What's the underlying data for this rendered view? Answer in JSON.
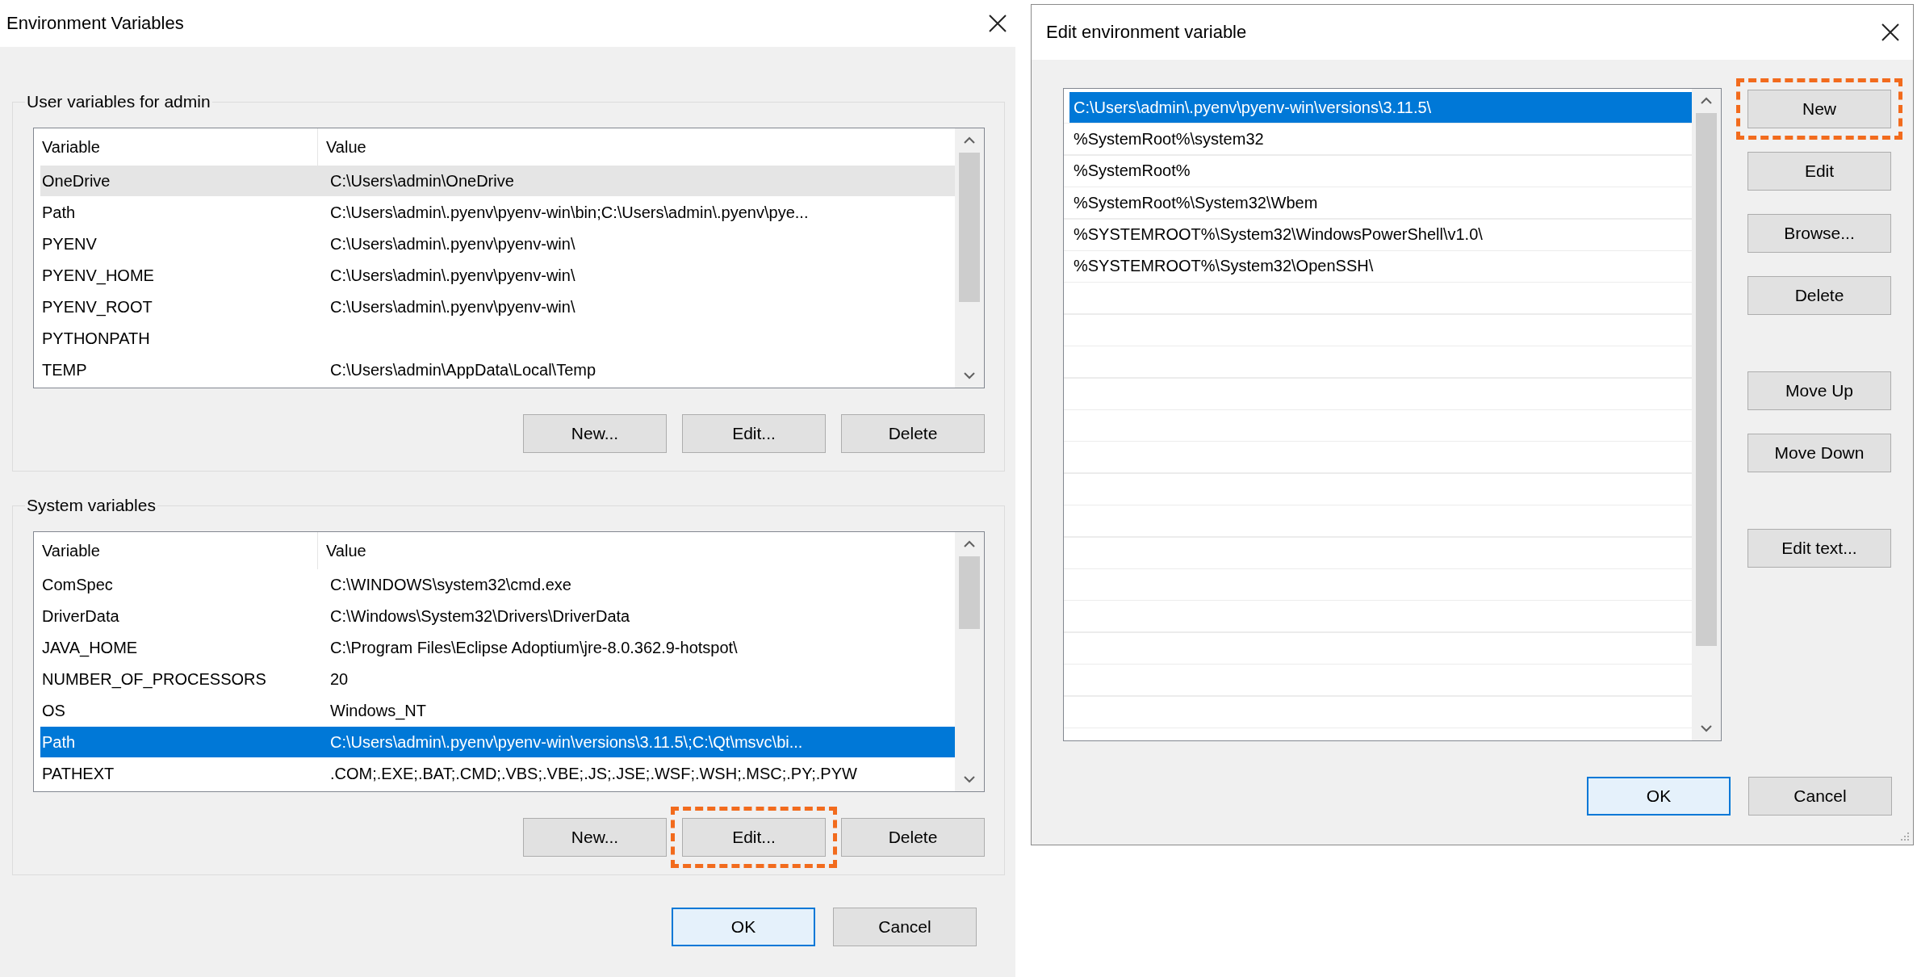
{
  "env_window": {
    "title": "Environment Variables",
    "groups": [
      {
        "label": "User variables for admin",
        "columns": [
          "Variable",
          "Value"
        ],
        "focused": false,
        "rows": [
          {
            "variable": "OneDrive",
            "value": "C:\\Users\\admin\\OneDrive",
            "selected": true
          },
          {
            "variable": "Path",
            "value": "C:\\Users\\admin\\.pyenv\\pyenv-win\\bin;C:\\Users\\admin\\.pyenv\\pye...",
            "selected": false
          },
          {
            "variable": "PYENV",
            "value": "C:\\Users\\admin\\.pyenv\\pyenv-win\\",
            "selected": false
          },
          {
            "variable": "PYENV_HOME",
            "value": "C:\\Users\\admin\\.pyenv\\pyenv-win\\",
            "selected": false
          },
          {
            "variable": "PYENV_ROOT",
            "value": "C:\\Users\\admin\\.pyenv\\pyenv-win\\",
            "selected": false
          },
          {
            "variable": "PYTHONPATH",
            "selected": false
          },
          {
            "variable": "TEMP",
            "value": "C:\\Users\\admin\\AppData\\Local\\Temp",
            "selected": false
          }
        ],
        "buttons": [
          {
            "label": "New...",
            "highlighted": false
          },
          {
            "label": "Edit...",
            "highlighted": false
          },
          {
            "label": "Delete",
            "highlighted": false
          }
        ]
      },
      {
        "label": "System variables",
        "columns": [
          "Variable",
          "Value"
        ],
        "focused": true,
        "rows": [
          {
            "variable": "ComSpec",
            "value": "C:\\WINDOWS\\system32\\cmd.exe",
            "selected": false
          },
          {
            "variable": "DriverData",
            "value": "C:\\Windows\\System32\\Drivers\\DriverData",
            "selected": false
          },
          {
            "variable": "JAVA_HOME",
            "value": "C:\\Program Files\\Eclipse Adoptium\\jre-8.0.362.9-hotspot\\",
            "selected": false
          },
          {
            "variable": "NUMBER_OF_PROCESSORS",
            "value": "20",
            "selected": false
          },
          {
            "variable": "OS",
            "value": "Windows_NT",
            "selected": false
          },
          {
            "variable": "Path",
            "value": "C:\\Users\\admin\\.pyenv\\pyenv-win\\versions\\3.11.5\\;C:\\Qt\\msvc\\bi...",
            "selected": true
          },
          {
            "variable": "PATHEXT",
            "value": ".COM;.EXE;.BAT;.CMD;.VBS;.VBE;.JS;.JSE;.WSF;.WSH;.MSC;.PY;.PYW",
            "selected": false
          }
        ],
        "buttons": [
          {
            "label": "New...",
            "highlighted": false
          },
          {
            "label": "Edit...",
            "highlighted": true
          },
          {
            "label": "Delete",
            "highlighted": false
          }
        ]
      }
    ],
    "buttons": [
      {
        "label": "OK",
        "default": true
      },
      {
        "label": "Cancel",
        "default": false
      }
    ]
  },
  "edit_window": {
    "title": "Edit environment variable",
    "focused": true,
    "items": [
      {
        "text": "C:\\Users\\admin\\.pyenv\\pyenv-win\\versions\\3.11.5\\",
        "selected": true
      },
      {
        "text": "%SystemRoot%\\system32",
        "selected": false
      },
      {
        "text": "%SystemRoot%",
        "selected": false
      },
      {
        "text": "%SystemRoot%\\System32\\Wbem",
        "selected": false
      },
      {
        "text": "%SYSTEMROOT%\\System32\\WindowsPowerShell\\v1.0\\",
        "selected": false
      },
      {
        "text": "%SYSTEMROOT%\\System32\\OpenSSH\\",
        "selected": false
      }
    ],
    "side_button_groups": [
      [
        {
          "label": "New",
          "highlighted": true
        },
        {
          "label": "Edit",
          "highlighted": false
        },
        {
          "label": "Browse...",
          "highlighted": false
        },
        {
          "label": "Delete",
          "highlighted": false
        }
      ],
      [
        {
          "label": "Move Up",
          "highlighted": false
        },
        {
          "label": "Move Down",
          "highlighted": false
        }
      ],
      [
        {
          "label": "Edit text...",
          "highlighted": false
        }
      ]
    ],
    "buttons": [
      {
        "label": "OK",
        "default": true
      },
      {
        "label": "Cancel",
        "default": false
      }
    ]
  }
}
